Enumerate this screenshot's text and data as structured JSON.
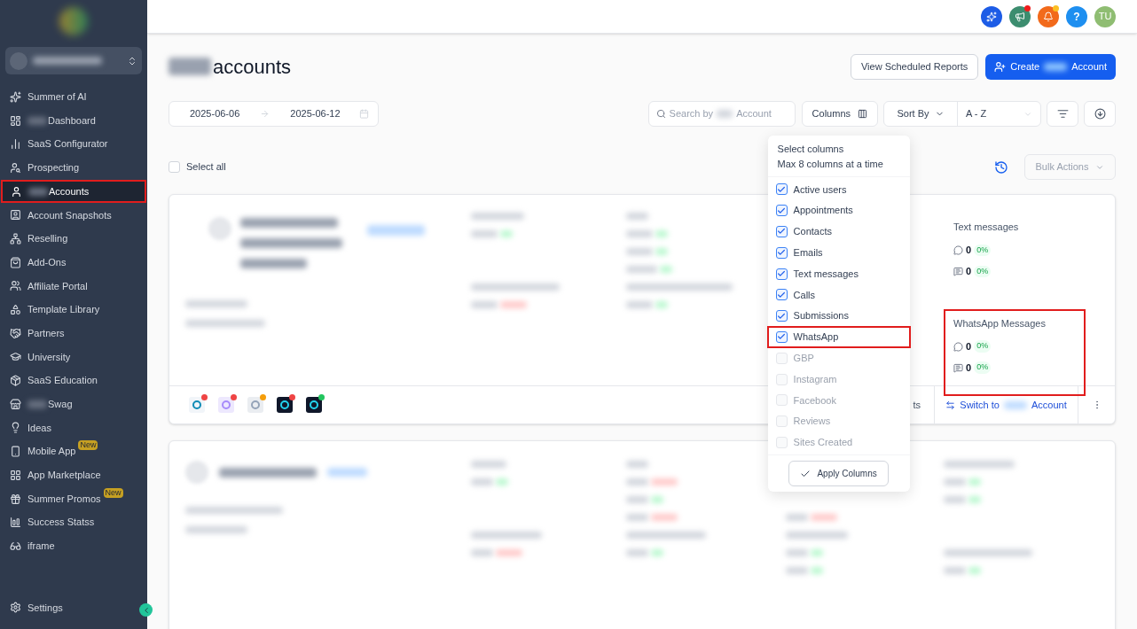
{
  "sidebar": {
    "items": [
      {
        "label": "Summer of AI",
        "blurred_prefix": false,
        "selected": false,
        "highlighted": false
      },
      {
        "label": "Dashboard",
        "blurred_prefix": true,
        "selected": false,
        "highlighted": false
      },
      {
        "label": "SaaS Configurator",
        "blurred_prefix": false,
        "selected": false,
        "highlighted": false
      },
      {
        "label": "Prospecting",
        "blurred_prefix": false,
        "selected": false,
        "highlighted": false
      },
      {
        "label": "Accounts",
        "blurred_prefix": true,
        "selected": true,
        "highlighted": true
      },
      {
        "label": "Account Snapshots",
        "blurred_prefix": false,
        "selected": false,
        "highlighted": false
      },
      {
        "label": "Reselling",
        "blurred_prefix": false,
        "selected": false,
        "highlighted": false
      },
      {
        "label": "Add-Ons",
        "blurred_prefix": false,
        "selected": false,
        "highlighted": false
      },
      {
        "label": "Affiliate Portal",
        "blurred_prefix": false,
        "selected": false,
        "highlighted": false
      },
      {
        "label": "Template Library",
        "blurred_prefix": false,
        "selected": false,
        "highlighted": false
      },
      {
        "label": "Partners",
        "blurred_prefix": false,
        "selected": false,
        "highlighted": false
      },
      {
        "label": "University",
        "blurred_prefix": false,
        "selected": false,
        "highlighted": false
      },
      {
        "label": "SaaS Education",
        "blurred_prefix": false,
        "selected": false,
        "highlighted": false
      },
      {
        "label": "Swag",
        "blurred_prefix": true,
        "selected": false,
        "highlighted": false
      },
      {
        "label": "Ideas",
        "blurred_prefix": false,
        "selected": false,
        "highlighted": false
      },
      {
        "label": "Mobile App",
        "blurred_prefix": false,
        "selected": false,
        "highlighted": false,
        "badge": "New"
      },
      {
        "label": "App Marketplace",
        "blurred_prefix": false,
        "selected": false,
        "highlighted": false
      },
      {
        "label": "Summer Promos",
        "blurred_prefix": false,
        "selected": false,
        "highlighted": false,
        "badge": "New"
      },
      {
        "label": "Success Statss",
        "blurred_prefix": false,
        "selected": false,
        "highlighted": false
      },
      {
        "label": "iframe",
        "blurred_prefix": false,
        "selected": false,
        "highlighted": false
      }
    ],
    "settings": "Settings"
  },
  "header": {
    "notifications": [
      {
        "unread": false
      },
      {
        "unread": true,
        "color": "#ef1c1c"
      },
      {
        "unread": true,
        "color": "#fbbf24"
      },
      {
        "unread": false,
        "label": "?"
      }
    ],
    "avatar": "TU"
  },
  "page": {
    "title": "accounts",
    "view_reports": "View Scheduled Reports",
    "create_start": "Create",
    "create_end": "Account"
  },
  "filters": {
    "date_start": "2025-06-06",
    "date_end": "2025-06-12",
    "search_start": "Search by",
    "search_end": "Account",
    "columns": "Columns",
    "sort_label": "Sort By",
    "sort_value": "A - Z"
  },
  "select_all": {
    "label": "Select all",
    "checked": false
  },
  "bulk_actions": {
    "label": "Bulk Actions",
    "disabled": true
  },
  "columns_menu": {
    "title": "Select columns",
    "subtitle": "Max 8 columns at a time",
    "apply": "Apply Columns",
    "options": [
      {
        "label": "Active users",
        "checked": true,
        "disabled": false,
        "highlighted": false
      },
      {
        "label": "Appointments",
        "checked": true,
        "disabled": false,
        "highlighted": false
      },
      {
        "label": "Contacts",
        "checked": true,
        "disabled": false,
        "highlighted": false
      },
      {
        "label": "Emails",
        "checked": true,
        "disabled": false,
        "highlighted": false
      },
      {
        "label": "Text messages",
        "checked": true,
        "disabled": false,
        "highlighted": false
      },
      {
        "label": "Calls",
        "checked": true,
        "disabled": false,
        "highlighted": false
      },
      {
        "label": "Submissions",
        "checked": true,
        "disabled": false,
        "highlighted": false
      },
      {
        "label": "WhatsApp",
        "checked": true,
        "disabled": false,
        "highlighted": true
      },
      {
        "label": "GBP",
        "checked": false,
        "disabled": true,
        "highlighted": false
      },
      {
        "label": "Instagram",
        "checked": false,
        "disabled": true,
        "highlighted": false
      },
      {
        "label": "Facebook",
        "checked": false,
        "disabled": true,
        "highlighted": false
      },
      {
        "label": "Reviews",
        "checked": false,
        "disabled": true,
        "highlighted": false
      },
      {
        "label": "Sites Created",
        "checked": false,
        "disabled": true,
        "highlighted": false
      }
    ]
  },
  "account_card": {
    "stats": [
      {
        "title": "Text messages",
        "highlighted": false,
        "rows": [
          {
            "value": "0",
            "change": "0%"
          },
          {
            "value": "0",
            "change": "0%"
          }
        ]
      },
      {
        "title": "WhatsApp Messages",
        "highlighted": true,
        "rows": [
          {
            "value": "0",
            "change": "0%"
          },
          {
            "value": "0",
            "change": "0%"
          }
        ]
      }
    ],
    "integrations": [
      {
        "color": "#ef4444"
      },
      {
        "color": "#ef4444"
      },
      {
        "color": "#f59e0b"
      },
      {
        "color": "#ef4444"
      },
      {
        "color": "#22c55e"
      }
    ],
    "partial_action": "ts",
    "switch_start": "Switch to",
    "switch_end": "Account"
  }
}
